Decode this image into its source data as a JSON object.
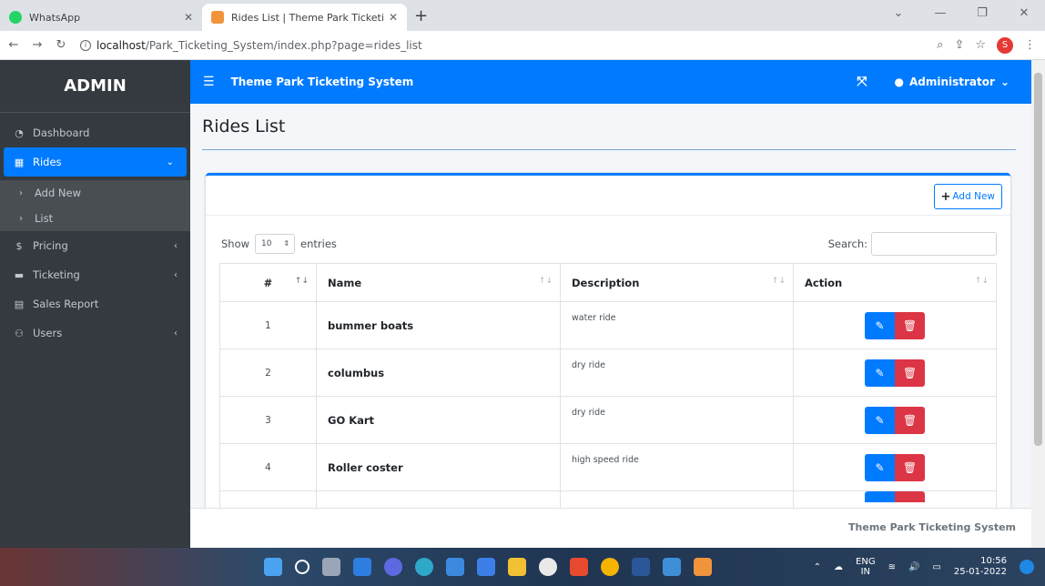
{
  "browser": {
    "tabs": [
      {
        "title": "WhatsApp"
      },
      {
        "title": "Rides List | Theme Park Ticketing"
      }
    ],
    "url_host": "localhost",
    "url_path": "/Park_Ticketing_System/index.php?page=rides_list",
    "profile_initial": "S"
  },
  "sidebar": {
    "brand": "ADMIN",
    "items": [
      {
        "label": "Dashboard",
        "icon": "dashboard-icon"
      },
      {
        "label": "Rides",
        "icon": "table-icon"
      },
      {
        "label": "Add New",
        "icon": "chevron-right-icon"
      },
      {
        "label": "List",
        "icon": "chevron-right-icon"
      },
      {
        "label": "Pricing",
        "icon": "dollar-icon"
      },
      {
        "label": "Ticketing",
        "icon": "ticket-icon"
      },
      {
        "label": "Sales Report",
        "icon": "report-icon"
      },
      {
        "label": "Users",
        "icon": "users-icon"
      }
    ]
  },
  "header": {
    "title": "Theme Park Ticketing System",
    "user": "Administrator"
  },
  "main": {
    "page_title": "Rides List",
    "add_new_label": "Add New",
    "show_label": "Show",
    "entries_value": "10",
    "entries_label": "entries",
    "search_label": "Search:",
    "table": {
      "headers": [
        "#",
        "Name",
        "Description",
        "Action"
      ],
      "rows": [
        {
          "num": "1",
          "name": "bummer boats",
          "desc": "water ride"
        },
        {
          "num": "2",
          "name": "columbus",
          "desc": "dry ride"
        },
        {
          "num": "3",
          "name": "GO Kart",
          "desc": "dry ride"
        },
        {
          "num": "4",
          "name": "Roller coster",
          "desc": "high speed ride"
        }
      ]
    }
  },
  "footer": {
    "text": "Theme Park Ticketing System"
  },
  "taskbar": {
    "lang_top": "ENG",
    "lang_bottom": "IN",
    "time": "10:56",
    "date": "25-01-2022"
  },
  "colors": {
    "primary": "#007bff",
    "danger": "#dc3545",
    "sidebar_bg": "#343a40"
  }
}
